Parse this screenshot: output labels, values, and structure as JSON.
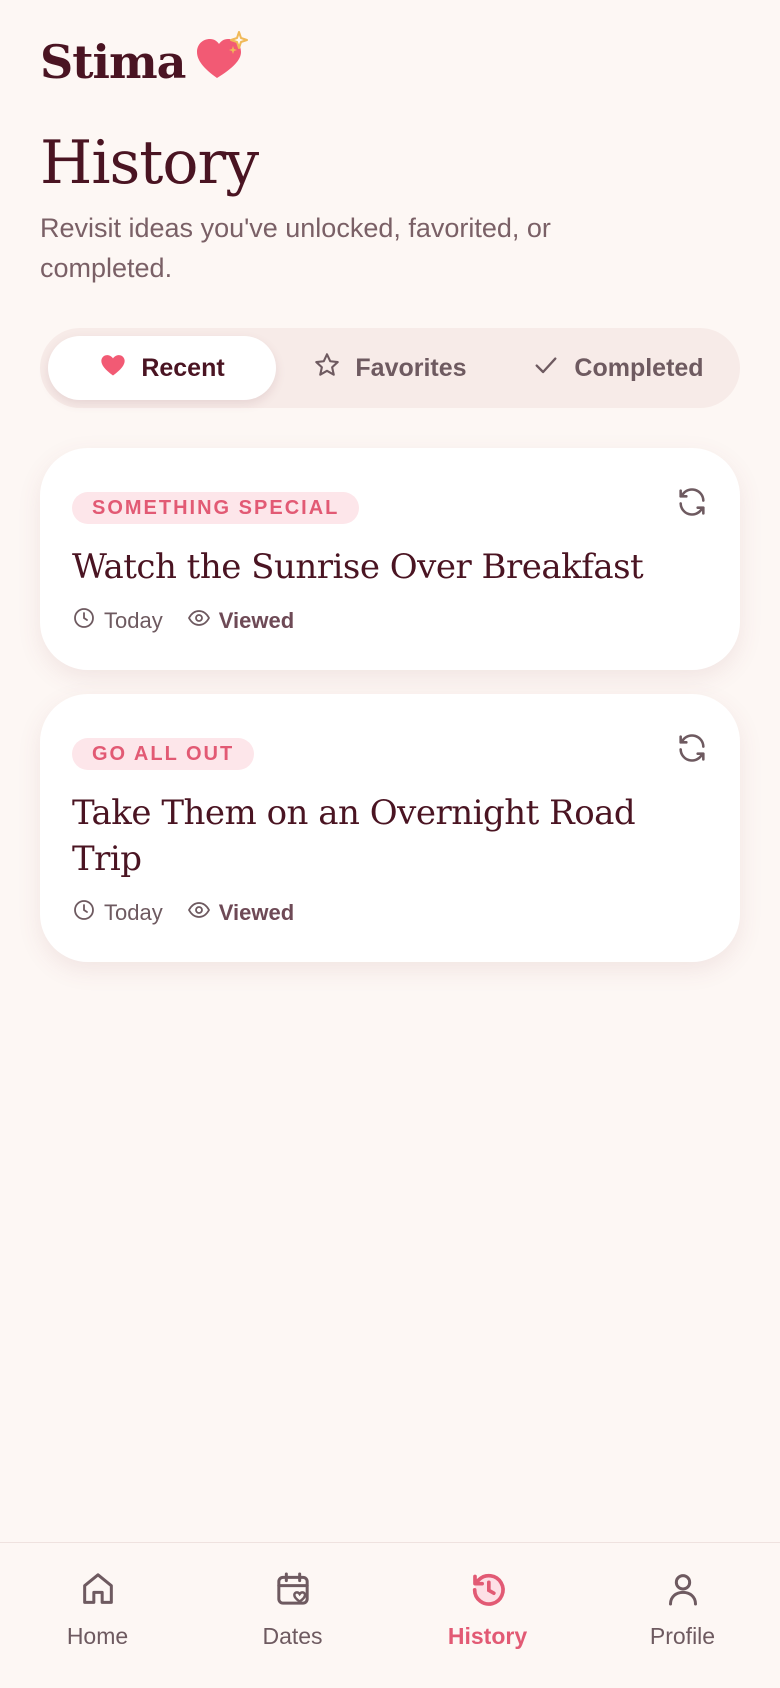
{
  "app": {
    "name": "Stima"
  },
  "page": {
    "title": "History",
    "subtitle": "Revisit ideas you've unlocked, favorited, or completed."
  },
  "tabs": [
    {
      "label": "Recent",
      "icon": "heart-icon",
      "active": true
    },
    {
      "label": "Favorites",
      "icon": "star-icon",
      "active": false
    },
    {
      "label": "Completed",
      "icon": "check-icon",
      "active": false
    }
  ],
  "cards": [
    {
      "badge": "SOMETHING SPECIAL",
      "title": "Watch the Sunrise Over Breakfast",
      "time": "Today",
      "status": "Viewed"
    },
    {
      "badge": "GO ALL OUT",
      "title": "Take Them on an Overnight Road Trip",
      "time": "Today",
      "status": "Viewed"
    }
  ],
  "nav": [
    {
      "label": "Home",
      "icon": "home-icon",
      "active": false
    },
    {
      "label": "Dates",
      "icon": "calendar-heart-icon",
      "active": false
    },
    {
      "label": "History",
      "icon": "history-icon",
      "active": true
    },
    {
      "label": "Profile",
      "icon": "person-icon",
      "active": false
    }
  ],
  "colors": {
    "background": "#fdf7f4",
    "primary_text": "#4a1422",
    "accent": "#e25a74",
    "badge_bg": "#fde6ea",
    "heart": "#f25a74",
    "sparkle": "#f0b957"
  }
}
